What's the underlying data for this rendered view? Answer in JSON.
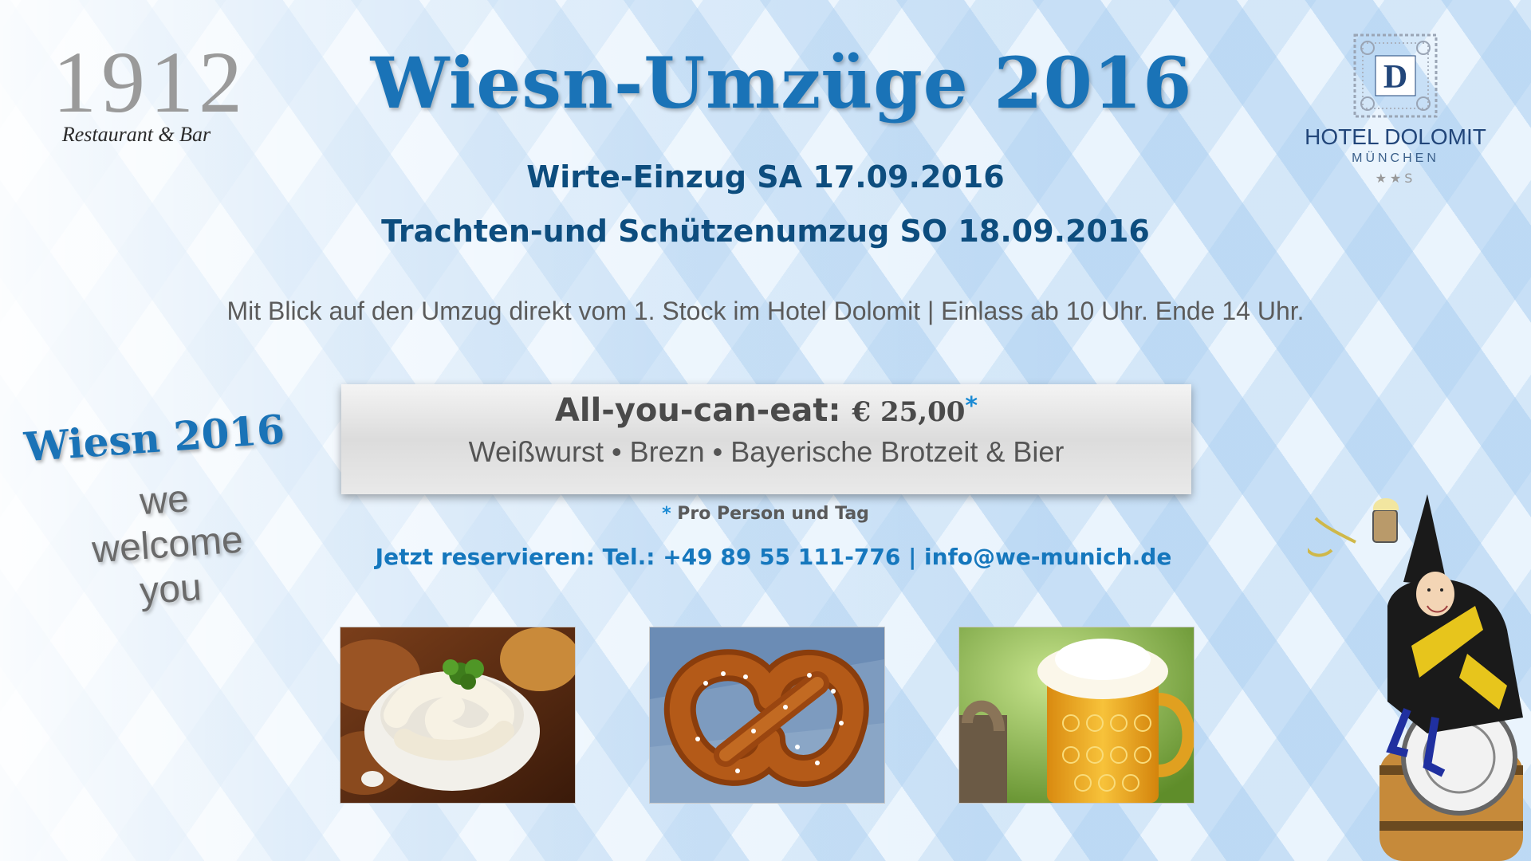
{
  "brand": {
    "restaurant_number": "1912",
    "restaurant_sub": "Restaurant & Bar"
  },
  "header": {
    "title": "Wiesn-Umzüge 2016",
    "date1": "Wirte-Einzug SA 17.09.2016",
    "date2": "Trachten-und Schützenumzug SO 18.09.2016"
  },
  "info": {
    "text": "Mit Blick auf den Umzug direkt vom 1. Stock im Hotel Dolomit | Einlass ab 10 Uhr. Ende 14 Uhr."
  },
  "offer": {
    "label": "All-you-can-eat:",
    "price": "€ 25,00",
    "asterisk": "*",
    "items": "Weißwurst • Brezn • Bayerische Brotzeit & Bier",
    "footnote_star": "*",
    "footnote": "Pro Person und Tag"
  },
  "reservation": {
    "text": "Jetzt reservieren: Tel.: +49 89 55 111-776 | info@we-munich.de"
  },
  "side": {
    "wiesn": "Wiesn 2016",
    "line1": "we",
    "line2": "welcome",
    "line3": "you"
  },
  "hotel": {
    "emblem_letter": "D",
    "name": "HOTEL DOLOMIT",
    "city": "MÜNCHEN",
    "stars": "★★S"
  },
  "photos": {
    "icons": [
      "weisswurst-photo",
      "pretzel-photo",
      "beer-photo"
    ]
  },
  "colors": {
    "title_blue": "#1a73b7",
    "dark_blue": "#0d4d7e",
    "link_blue": "#1577bd",
    "text_gray": "#5b5b5b"
  }
}
